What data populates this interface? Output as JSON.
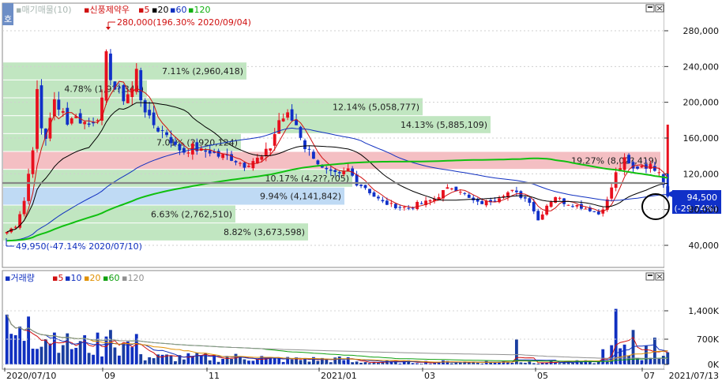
{
  "header": {
    "tag": "호",
    "legend_prefix": "▪매기매물(10)",
    "legend_name": "▪신풍제약우",
    "ma_items": [
      {
        "label": "▪5",
        "color": "#d01010"
      },
      {
        "label": "▪20",
        "color": "#000000"
      },
      {
        "label": "▪60",
        "color": "#1030c0"
      },
      {
        "label": "▪120",
        "color": "#10b010"
      }
    ]
  },
  "volume_header": {
    "title": "▪거래량",
    "ma_items": [
      {
        "label": "▪5",
        "color": "#d01010"
      },
      {
        "label": "▪10",
        "color": "#1030c0"
      },
      {
        "label": "▪20",
        "color": "#e09000"
      },
      {
        "label": "▪60",
        "color": "#10a010"
      },
      {
        "label": "▪120",
        "color": "#909090"
      }
    ]
  },
  "annotations": {
    "high": "280,000(196.30% 2020/09/04)",
    "low": "49,950(-47.14% 2020/07/10)"
  },
  "current": {
    "price": "94,500",
    "change": "(-29.74%)"
  },
  "colors": {
    "up": "#e8101e",
    "down": "#1030c8",
    "ma5": "#d01010",
    "ma20": "#000000",
    "ma60": "#1030c0",
    "ma120": "#10c010",
    "band_green": "#b6e2b6",
    "band_red": "#f2b4b8",
    "band_blue": "#b4d4f2"
  },
  "chart_data": [
    {
      "type": "candlestick",
      "title": "신풍제약우",
      "yticks": [
        "280,000",
        "240,000",
        "200,000",
        "160,000",
        "120,000",
        "80,000",
        "40,000"
      ],
      "ylim": [
        20000,
        300000
      ],
      "x_ticks": [
        "2020/07/10",
        "09",
        "11",
        "2021/01",
        "03",
        "05",
        "07",
        "2021/07/13"
      ],
      "volume_profile": [
        {
          "label": "7.11% (2,960,418)",
          "price_low": 225000,
          "price_high": 245000,
          "pct": 7.11
        },
        {
          "label": "4.78% (1,9??,341)",
          "price_low": 205000,
          "price_high": 225000,
          "pct": 4.78
        },
        {
          "label": "12.14% (5,058,777)",
          "price_low": 185000,
          "price_high": 205000,
          "pct": 12.14
        },
        {
          "label": "14.13% (5,885,109)",
          "price_low": 165000,
          "price_high": 185000,
          "pct": 14.13
        },
        {
          "label": "7.01% (2,920,124)",
          "price_low": 145000,
          "price_high": 165000,
          "pct": 7.01
        },
        {
          "label": "19.27% (8,02?,419)",
          "price_low": 125000,
          "price_high": 145000,
          "pct": 19.27
        },
        {
          "label": "10.17% (4,2??,?05)",
          "price_low": 105000,
          "price_high": 125000,
          "pct": 10.17
        },
        {
          "label": "9.94% (4,141,842)",
          "price_low": 85000,
          "price_high": 105000,
          "pct": 9.94
        },
        {
          "label": "6.63% (2,762,510)",
          "price_low": 65000,
          "price_high": 85000,
          "pct": 6.63
        },
        {
          "label": "8.82% (3,673,598)",
          "price_low": 45000,
          "price_high": 65000,
          "pct": 8.82
        }
      ],
      "close_series": [
        [
          0,
          55000
        ],
        [
          2,
          62000
        ],
        [
          4,
          90000
        ],
        [
          5,
          120000
        ],
        [
          6,
          150000
        ],
        [
          7,
          210000
        ],
        [
          8,
          170000
        ],
        [
          9,
          160000
        ],
        [
          10,
          185000
        ],
        [
          11,
          200000
        ],
        [
          12,
          190000
        ],
        [
          13,
          195000
        ],
        [
          14,
          175000
        ],
        [
          15,
          185000
        ],
        [
          17,
          180000
        ],
        [
          19,
          175000
        ],
        [
          21,
          185000
        ],
        [
          22,
          200000
        ],
        [
          23,
          250000
        ],
        [
          24,
          230000
        ],
        [
          25,
          215000
        ],
        [
          26,
          210000
        ],
        [
          27,
          205000
        ],
        [
          29,
          215000
        ],
        [
          30,
          235000
        ],
        [
          31,
          205000
        ],
        [
          33,
          180000
        ],
        [
          35,
          170000
        ],
        [
          37,
          165000
        ],
        [
          39,
          150000
        ],
        [
          41,
          145000
        ],
        [
          43,
          150000
        ],
        [
          45,
          145000
        ],
        [
          47,
          145000
        ],
        [
          49,
          140000
        ],
        [
          51,
          140000
        ],
        [
          53,
          135000
        ],
        [
          55,
          130000
        ],
        [
          57,
          135000
        ],
        [
          59,
          138000
        ],
        [
          61,
          150000
        ],
        [
          63,
          180000
        ],
        [
          65,
          185000
        ],
        [
          67,
          175000
        ],
        [
          69,
          150000
        ],
        [
          71,
          140000
        ],
        [
          73,
          125000
        ],
        [
          75,
          120000
        ],
        [
          77,
          118000
        ],
        [
          79,
          125000
        ],
        [
          81,
          110000
        ],
        [
          83,
          105000
        ],
        [
          85,
          95000
        ],
        [
          87,
          88000
        ],
        [
          89,
          85000
        ],
        [
          91,
          83000
        ],
        [
          93,
          82000
        ],
        [
          95,
          86000
        ],
        [
          97,
          88000
        ],
        [
          99,
          92000
        ],
        [
          101,
          100000
        ],
        [
          103,
          105000
        ],
        [
          105,
          102000
        ],
        [
          107,
          92000
        ],
        [
          109,
          87000
        ],
        [
          111,
          88000
        ],
        [
          113,
          92000
        ],
        [
          115,
          98000
        ],
        [
          117,
          100000
        ],
        [
          119,
          95000
        ],
        [
          121,
          90000
        ],
        [
          123,
          68000
        ],
        [
          125,
          85000
        ],
        [
          127,
          95000
        ],
        [
          129,
          88000
        ],
        [
          131,
          86000
        ],
        [
          133,
          83000
        ],
        [
          135,
          80000
        ],
        [
          137,
          75000
        ],
        [
          139,
          90000
        ],
        [
          141,
          120000
        ],
        [
          143,
          135000
        ],
        [
          145,
          125000
        ],
        [
          147,
          130000
        ],
        [
          149,
          128000
        ],
        [
          151,
          125000
        ],
        [
          153,
          94500
        ]
      ],
      "volume_yticks": [
        "1,400K",
        "700K",
        "0K"
      ],
      "current_price": 94500
    }
  ]
}
